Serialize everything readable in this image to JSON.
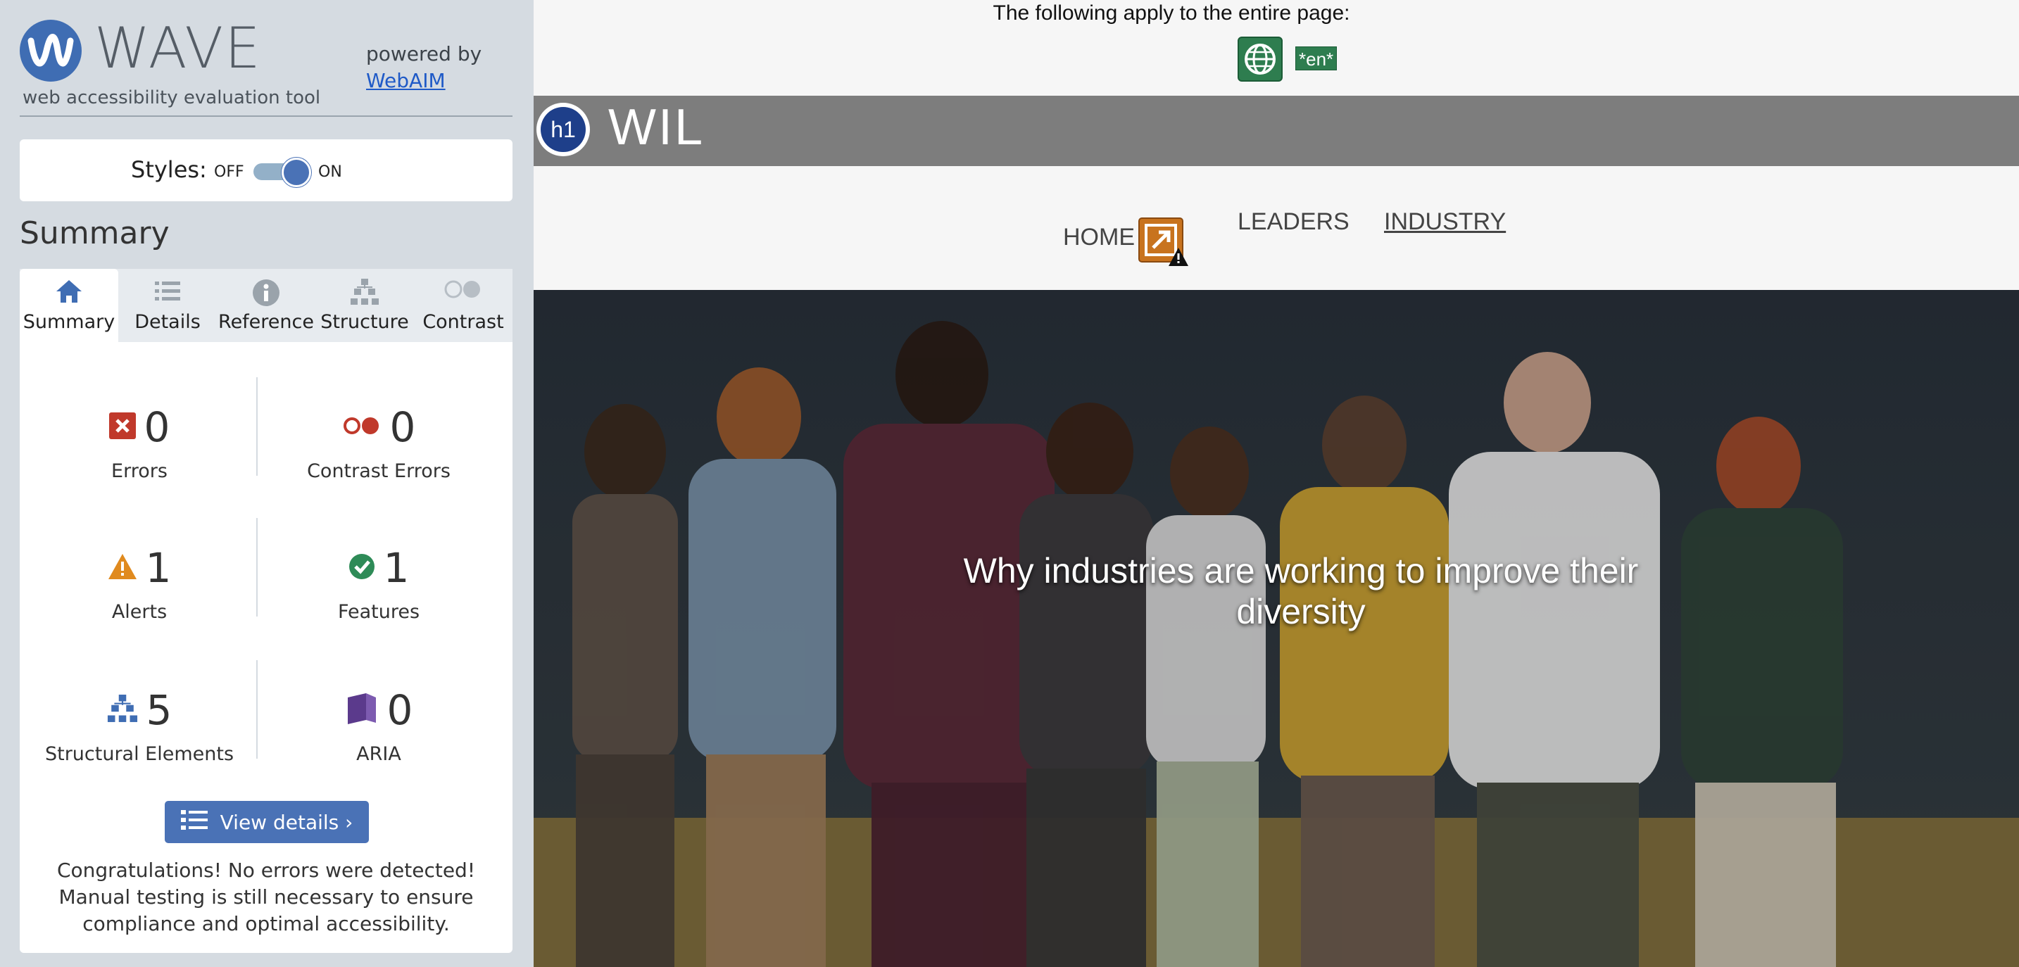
{
  "wave": {
    "title": "WAVE",
    "subtitle": "web accessibility evaluation tool",
    "powered_by": "powered by",
    "webaim_link": "WebAIM",
    "styles_label": "Styles:",
    "toggle_off": "OFF",
    "toggle_on": "ON",
    "summary_heading": "Summary",
    "tabs": [
      {
        "label": "Summary",
        "icon": "home-icon",
        "active": true
      },
      {
        "label": "Details",
        "icon": "list-icon",
        "active": false
      },
      {
        "label": "Reference",
        "icon": "info-icon",
        "active": false
      },
      {
        "label": "Structure",
        "icon": "hierarchy-icon",
        "active": false
      },
      {
        "label": "Contrast",
        "icon": "contrast-icon",
        "active": false
      }
    ],
    "stats": {
      "errors": {
        "value": "0",
        "label": "Errors",
        "icon": "error-icon"
      },
      "contrast_errors": {
        "value": "0",
        "label": "Contrast Errors",
        "icon": "contrast-error-icon"
      },
      "alerts": {
        "value": "1",
        "label": "Alerts",
        "icon": "alert-icon"
      },
      "features": {
        "value": "1",
        "label": "Features",
        "icon": "feature-icon"
      },
      "structural": {
        "value": "5",
        "label": "Structural Elements",
        "icon": "structure-icon"
      },
      "aria": {
        "value": "0",
        "label": "ARIA",
        "icon": "aria-icon"
      }
    },
    "view_details": "View details ›",
    "congrats": "Congratulations! No errors were detected! Manual testing is still necessary to ensure compliance and optimal accessibility."
  },
  "page": {
    "applies_text": "The following apply to the entire page:",
    "lang_badge": "*en*",
    "h1_badge": "h1",
    "site_title": "WIL",
    "nav": {
      "home": "HOME",
      "leaders": "LEADERS",
      "industry": "INDUSTRY"
    },
    "hero_text": "Why industries are working to improve their diversity"
  },
  "colors": {
    "wave_blue": "#4a72b6",
    "sidebar_bg": "#d5dbe1",
    "error_red": "#c0392b",
    "alert_orange": "#e08a1e",
    "feature_green": "#2e8b57",
    "aria_purple": "#5b3a8c",
    "header_gray": "#7d7d7d"
  }
}
